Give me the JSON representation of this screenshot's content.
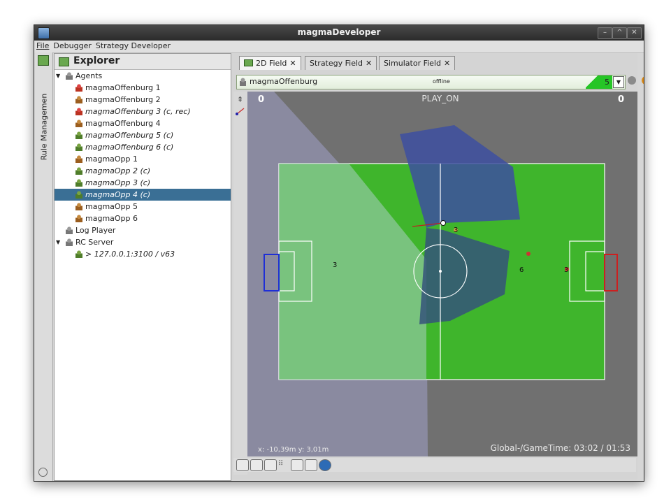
{
  "window": {
    "title": "magmaDeveloper"
  },
  "menu": [
    "File",
    "Debugger",
    "Strategy Developer"
  ],
  "left_strip": {
    "label": "Rule Managemen"
  },
  "explorer": {
    "title": "Explorer",
    "agents_label": "Agents",
    "agents": [
      {
        "label": "magmaOffenburg 1",
        "italic": false,
        "icon": "red"
      },
      {
        "label": "magmaOffenburg 2",
        "italic": false,
        "icon": "orange"
      },
      {
        "label": "magmaOffenburg 3 (c, rec)",
        "italic": true,
        "icon": "red"
      },
      {
        "label": "magmaOffenburg 4",
        "italic": false,
        "icon": "orange"
      },
      {
        "label": "magmaOffenburg 5 (c)",
        "italic": true,
        "icon": "green"
      },
      {
        "label": "magmaOffenburg 6 (c)",
        "italic": true,
        "icon": "green"
      },
      {
        "label": "magmaOpp 1",
        "italic": false,
        "icon": "orange"
      },
      {
        "label": "magmaOpp 2 (c)",
        "italic": true,
        "icon": "green"
      },
      {
        "label": "magmaOpp 3 (c)",
        "italic": true,
        "icon": "green"
      },
      {
        "label": "magmaOpp 4 (c)",
        "italic": true,
        "icon": "green",
        "selected": true
      },
      {
        "label": "magmaOpp 5",
        "italic": false,
        "icon": "orange"
      },
      {
        "label": "magmaOpp 6",
        "italic": false,
        "icon": "orange"
      }
    ],
    "log_player": "Log Player",
    "rc_server": "RC Server",
    "rc_entry": "> 127.0.0.1:3100 / v63"
  },
  "tabs": [
    {
      "label": "2D Field",
      "close": "✕",
      "active": true
    },
    {
      "label": "Strategy Field",
      "close": "✕",
      "active": false
    },
    {
      "label": "Simulator Field",
      "close": "✕",
      "active": false
    }
  ],
  "agent_bar": {
    "name": "magmaOffenburg",
    "status": "offline",
    "count": "5"
  },
  "field": {
    "score_left": "0",
    "score_right": "0",
    "play_mode": "PLAY_ON",
    "coords": "x: -10,39m  y: 3,01m",
    "time": "Global-/GameTime: 03:02 / 01:53",
    "player_numbers": [
      "3",
      "3",
      "6",
      "3"
    ]
  },
  "colors": {
    "field_green": "#3fb52c",
    "accent_selected": "#3a6f95",
    "left_goal": "#1f2fd6",
    "right_goal": "#cc2020"
  }
}
